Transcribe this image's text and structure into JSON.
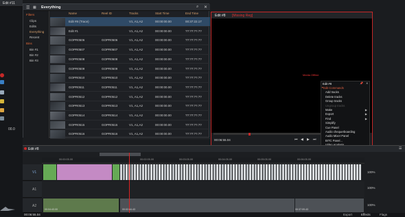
{
  "top_tab": {
    "title": "Edit #11"
  },
  "left_strip": {
    "value": "00.0"
  },
  "browser": {
    "title": "Everything",
    "sidebar": {
      "filters_label": "Filters",
      "filters": [
        "Clips",
        "Edits",
        "Everything",
        "Recent"
      ],
      "bins_label": "Bins",
      "bins": [
        "Bin #1",
        "Bin #2",
        "Bin #3"
      ]
    },
    "columns": [
      "Name",
      "Reel ID",
      "Tracks",
      "Start Time",
      "End Time"
    ],
    "rows": [
      {
        "name": "Edit #8 (Trace)",
        "reel": "",
        "tracks": "V1, A1,A2",
        "start": "00:00:00.00",
        "end": "00:37:22.17"
      },
      {
        "name": "Edit #1",
        "reel": "",
        "tracks": "V1, A1,A2",
        "start": "00:00:00.00",
        "end": "??:??:??.??"
      },
      {
        "name": "GOPR0506",
        "reel": "GOPR0506",
        "tracks": "V1, A1,A2",
        "start": "00:00:00.00",
        "end": "??:??:??.??"
      },
      {
        "name": "GOPR0507",
        "reel": "GOPR0507",
        "tracks": "V1, A1,A2",
        "start": "00:00:00.00",
        "end": "??:??:??.??"
      },
      {
        "name": "GOPR0508",
        "reel": "GOPR0508",
        "tracks": "V1, A1,A2",
        "start": "00:00:00.00",
        "end": "??:??:??.??"
      },
      {
        "name": "GOPR0509",
        "reel": "GOPR0509",
        "tracks": "V1, A1,A2",
        "start": "00:00:00.00",
        "end": "??:??:??.??"
      },
      {
        "name": "GOPR0510",
        "reel": "GOPR0510",
        "tracks": "V1, A1,A2",
        "start": "00:00:00.00",
        "end": "??:??:??.??"
      },
      {
        "name": "GOPR0511",
        "reel": "GOPR0511",
        "tracks": "V1, A1,A2",
        "start": "00:00:00.00",
        "end": "??:??:??.??"
      },
      {
        "name": "GOPR0512",
        "reel": "GOPR0512",
        "tracks": "V1, A1,A2",
        "start": "00:00:00.00",
        "end": "??:??:??.??"
      },
      {
        "name": "GOPR0513",
        "reel": "GOPR0513",
        "tracks": "V1, A1,A2",
        "start": "00:00:00.00",
        "end": "??:??:??.??"
      },
      {
        "name": "GOPR0514",
        "reel": "GOPR0514",
        "tracks": "V1, A1,A2",
        "start": "00:00:00.00",
        "end": "??:??:??.??"
      },
      {
        "name": "GOPR0515",
        "reel": "GOPR0515",
        "tracks": "V1, A1,A2",
        "start": "00:00:00.00",
        "end": "??:??:??.??"
      },
      {
        "name": "GOPR0516",
        "reel": "GOPR0516",
        "tracks": "V1, A1,A2",
        "start": "00:00:00.00",
        "end": "??:??:??.??"
      }
    ]
  },
  "viewer": {
    "title": "Edit #8",
    "subtitle": "[Missing Reg]",
    "message": "Media Offline",
    "timecode": "00:06:55.04"
  },
  "context_menu": {
    "edit_title": "Edit #8",
    "sections": [
      {
        "label": "Edit Commands",
        "items": [
          {
            "label": "Add tracks",
            "enabled": true
          },
          {
            "label": "Delete tracks",
            "enabled": true
          },
          {
            "label": "Group tracks",
            "enabled": true
          },
          {
            "label": "Ungroup tracks",
            "enabled": false
          },
          {
            "label": "Make",
            "enabled": true,
            "submenu": true
          },
          {
            "label": "Export",
            "enabled": true,
            "submenu": true
          },
          {
            "label": "Find",
            "enabled": true,
            "submenu": true
          },
          {
            "label": "Simplify",
            "enabled": true
          },
          {
            "label": "Cue Panel",
            "enabled": true
          },
          {
            "label": "Audio chequerboarding",
            "enabled": true
          },
          {
            "label": "Audio Mixer Panel",
            "enabled": true
          },
          {
            "label": "BITC Panel...",
            "enabled": true
          },
          {
            "label": "Video Analysis...",
            "enabled": true
          },
          {
            "label": "Legalise Timecode",
            "enabled": false
          }
        ]
      },
      {
        "label": "Viewer Commands",
        "items": [
          {
            "label": "Trim view enabled",
            "enabled": true,
            "value": "Yes"
          }
        ]
      }
    ]
  },
  "timeline": {
    "title": "Edit #8",
    "tracks": [
      {
        "label": "V1"
      },
      {
        "label": "A1"
      },
      {
        "label": "A2"
      }
    ],
    "ruler": [
      "00:00:05.00",
      "00:02:05.00",
      "00:03:05.00",
      "00:04:05.00",
      "00:05:05.00",
      "00:06:05.00"
    ],
    "levels": [
      "100%",
      "100%",
      "100%"
    ],
    "bottom_timecodes": [
      "00:04:43.00",
      "00:02:44.43",
      "00:37:09.43"
    ],
    "footer_time": "00:06:55.04",
    "footer_buttons": [
      "Export",
      "Effects",
      "Flags"
    ]
  },
  "colors": {
    "accent": "#c62828",
    "clip_video": "#c48ac4",
    "clip_green": "#66aa55",
    "clip_audio": "#5e7a4c"
  }
}
